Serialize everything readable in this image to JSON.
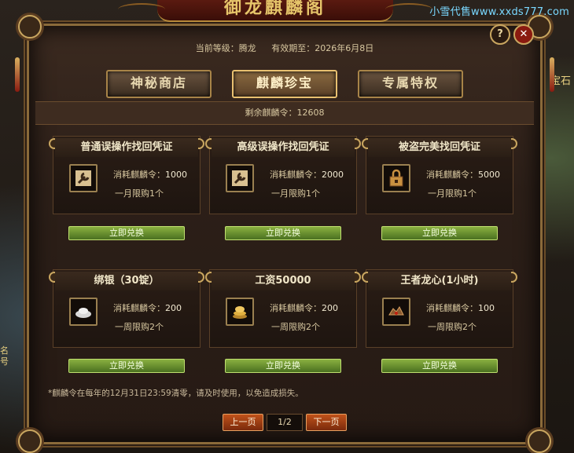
{
  "watermark": "小雪代售www.xxds777.com",
  "side_left": "名\n号",
  "side_right": "宝石",
  "banner_title": "御龙麒麟阁",
  "header": {
    "level_label": "当前等级：腾龙",
    "expiry_label": "有效期至：2026年6月8日",
    "help": "?",
    "close": "✕"
  },
  "tabs": [
    {
      "label": "神秘商店",
      "active": false
    },
    {
      "label": "麒麟珍宝",
      "active": true
    },
    {
      "label": "专属特权",
      "active": false
    }
  ],
  "remaining": "剩余麒麟令：12608",
  "cards": [
    {
      "title": "普通误操作找回凭证",
      "cost_label": "消耗麒麟令：",
      "cost": "1000",
      "limit": "一月限购1个",
      "icon": "wrench-icon",
      "button": "立即兑换"
    },
    {
      "title": "高级误操作找回凭证",
      "cost_label": "消耗麒麟令：",
      "cost": "2000",
      "limit": "一月限购1个",
      "icon": "wrench-icon",
      "button": "立即兑换"
    },
    {
      "title": "被盗完美找回凭证",
      "cost_label": "消耗麒麟令：",
      "cost": "5000",
      "limit": "一月限购1个",
      "icon": "lock-icon",
      "button": "立即兑换"
    },
    {
      "title": "绑银（30锭）",
      "cost_label": "消耗麒麟令：",
      "cost": "200",
      "limit": "一周限购2个",
      "icon": "silver-ingot-icon",
      "button": "立即兑换"
    },
    {
      "title": "工资50000",
      "cost_label": "消耗麒麟令：",
      "cost": "200",
      "limit": "一周限购2个",
      "icon": "gold-coins-icon",
      "button": "立即兑换"
    },
    {
      "title": "王者龙心(1小时)",
      "cost_label": "消耗麒麟令：",
      "cost": "100",
      "limit": "一周限购2个",
      "icon": "dragon-heart-icon",
      "button": "立即兑换"
    }
  ],
  "note": "*麒麟令在每年的12月31日23:59清零，请及时使用，以免造成损失。",
  "pager": {
    "prev": "上一页",
    "page": "1/2",
    "next": "下一页"
  },
  "colors": {
    "accent_gold": "#c9a660",
    "button_green": "#8ab040",
    "pager_orange": "#c0521a"
  }
}
